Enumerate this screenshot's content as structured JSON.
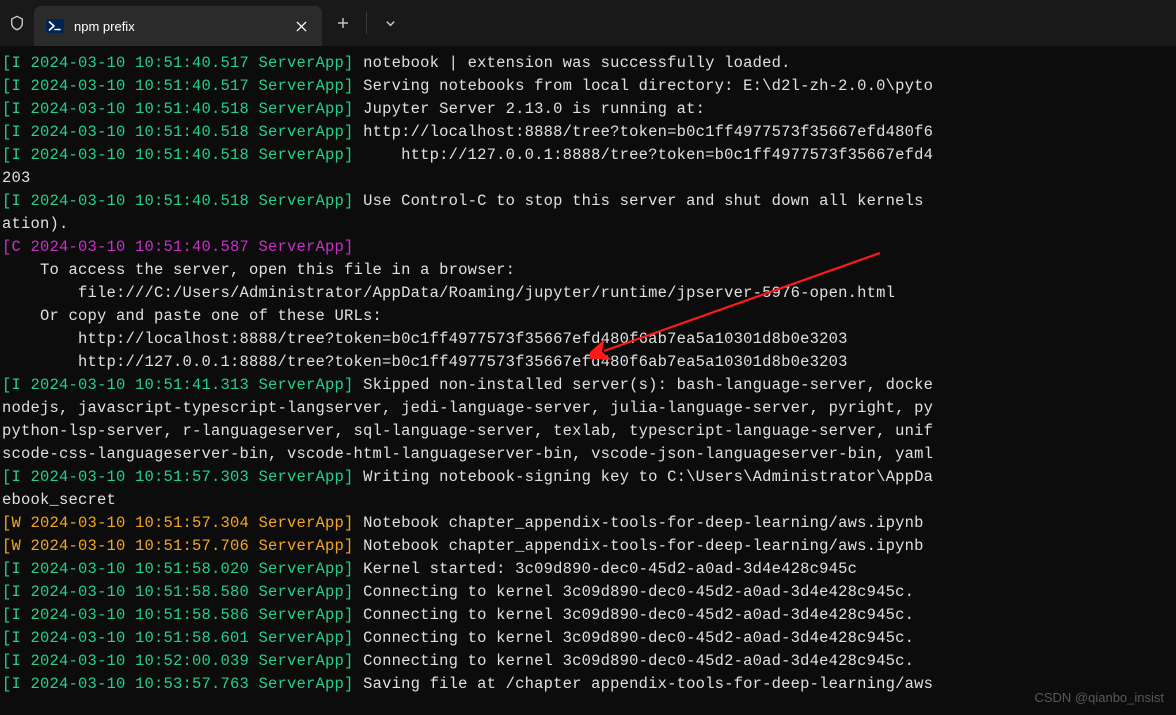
{
  "tab": {
    "title": "npm prefix"
  },
  "watermark": "CSDN @qianbo_insist",
  "lines": [
    {
      "lvl": "I",
      "ts": "2024-03-10 10:51:40.517",
      "src": "ServerApp",
      "msg": " notebook | extension was successfully loaded."
    },
    {
      "lvl": "I",
      "ts": "2024-03-10 10:51:40.517",
      "src": "ServerApp",
      "msg": " Serving notebooks from local directory: E:\\d2l-zh-2.0.0\\pyto"
    },
    {
      "lvl": "I",
      "ts": "2024-03-10 10:51:40.518",
      "src": "ServerApp",
      "msg": " Jupyter Server 2.13.0 is running at:"
    },
    {
      "lvl": "I",
      "ts": "2024-03-10 10:51:40.518",
      "src": "ServerApp",
      "msg": " http://localhost:8888/tree?token=b0c1ff4977573f35667efd480f6"
    },
    {
      "lvl": "I",
      "ts": "2024-03-10 10:51:40.518",
      "src": "ServerApp",
      "msg": "     http://127.0.0.1:8888/tree?token=b0c1ff4977573f35667efd4"
    },
    {
      "plain": "203"
    },
    {
      "lvl": "I",
      "ts": "2024-03-10 10:51:40.518",
      "src": "ServerApp",
      "msg": " Use Control-C to stop this server and shut down all kernels "
    },
    {
      "plain": "ation)."
    },
    {
      "lvl": "C",
      "ts": "2024-03-10 10:51:40.587",
      "src": "ServerApp",
      "msg": ""
    },
    {
      "plain": ""
    },
    {
      "plain": "    To access the server, open this file in a browser:"
    },
    {
      "plain": "        file:///C:/Users/Administrator/AppData/Roaming/jupyter/runtime/jpserver-5976-open.html"
    },
    {
      "plain": "    Or copy and paste one of these URLs:"
    },
    {
      "plain": "        http://localhost:8888/tree?token=b0c1ff4977573f35667efd480f6ab7ea5a10301d8b0e3203"
    },
    {
      "plain": "        http://127.0.0.1:8888/tree?token=b0c1ff4977573f35667efd480f6ab7ea5a10301d8b0e3203"
    },
    {
      "lvl": "I",
      "ts": "2024-03-10 10:51:41.313",
      "src": "ServerApp",
      "msg": " Skipped non-installed server(s): bash-language-server, docke"
    },
    {
      "plain": "nodejs, javascript-typescript-langserver, jedi-language-server, julia-language-server, pyright, py"
    },
    {
      "plain": "python-lsp-server, r-languageserver, sql-language-server, texlab, typescript-language-server, unif"
    },
    {
      "plain": "scode-css-languageserver-bin, vscode-html-languageserver-bin, vscode-json-languageserver-bin, yaml"
    },
    {
      "lvl": "I",
      "ts": "2024-03-10 10:51:57.303",
      "src": "ServerApp",
      "msg": " Writing notebook-signing key to C:\\Users\\Administrator\\AppDa"
    },
    {
      "plain": "ebook_secret"
    },
    {
      "lvl": "W",
      "ts": "2024-03-10 10:51:57.304",
      "src": "ServerApp",
      "msg": " Notebook chapter_appendix-tools-for-deep-learning/aws.ipynb "
    },
    {
      "lvl": "W",
      "ts": "2024-03-10 10:51:57.706",
      "src": "ServerApp",
      "msg": " Notebook chapter_appendix-tools-for-deep-learning/aws.ipynb "
    },
    {
      "lvl": "I",
      "ts": "2024-03-10 10:51:58.020",
      "src": "ServerApp",
      "msg": " Kernel started: 3c09d890-dec0-45d2-a0ad-3d4e428c945c"
    },
    {
      "lvl": "I",
      "ts": "2024-03-10 10:51:58.580",
      "src": "ServerApp",
      "msg": " Connecting to kernel 3c09d890-dec0-45d2-a0ad-3d4e428c945c."
    },
    {
      "lvl": "I",
      "ts": "2024-03-10 10:51:58.586",
      "src": "ServerApp",
      "msg": " Connecting to kernel 3c09d890-dec0-45d2-a0ad-3d4e428c945c."
    },
    {
      "lvl": "I",
      "ts": "2024-03-10 10:51:58.601",
      "src": "ServerApp",
      "msg": " Connecting to kernel 3c09d890-dec0-45d2-a0ad-3d4e428c945c."
    },
    {
      "lvl": "I",
      "ts": "2024-03-10 10:52:00.039",
      "src": "ServerApp",
      "msg": " Connecting to kernel 3c09d890-dec0-45d2-a0ad-3d4e428c945c."
    },
    {
      "lvl": "I",
      "ts": "2024-03-10 10:53:57.763",
      "src": "ServerApp",
      "msg": " Saving file at /chapter appendix-tools-for-deep-learning/aws"
    }
  ]
}
